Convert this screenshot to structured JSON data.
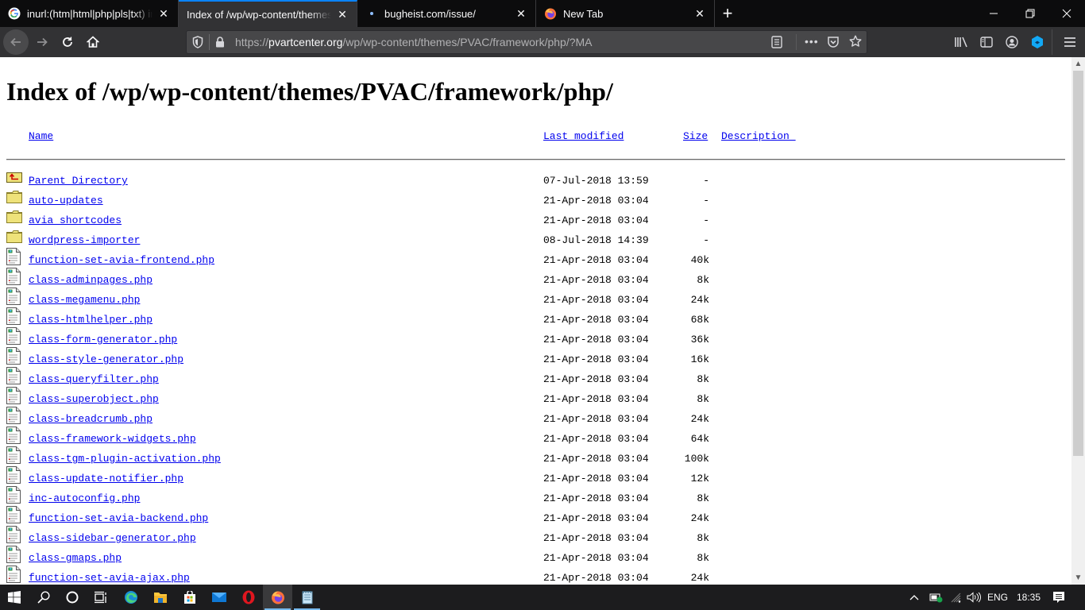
{
  "browser": {
    "tabs": [
      {
        "title": "inurl:(htm|html|php|pls|txt) intitle:index.of",
        "favicon": "google-g-icon",
        "active": false
      },
      {
        "title": "Index of /wp/wp-content/themes/PVAC/framework/php/",
        "favicon": "none",
        "active": true
      },
      {
        "title": "bugheist.com/issue/",
        "favicon": "loading-dot-icon",
        "active": false
      },
      {
        "title": "New Tab",
        "favicon": "firefox-icon",
        "active": false
      }
    ],
    "new_tab_label": "+",
    "url": {
      "scheme": "https://",
      "host": "pvartcenter.org",
      "path": "/wp/wp-content/themes/PVAC/framework/php/?MA"
    },
    "accent_color": "#0a84ff"
  },
  "page": {
    "title": "Index of /wp/wp-content/themes/PVAC/framework/php/",
    "columns": {
      "name": "Name",
      "last_modified": "Last modified",
      "size": "Size",
      "description": "Description "
    },
    "entries": [
      {
        "type": "parent",
        "name": "Parent Directory",
        "modified": "07-Jul-2018 13:59",
        "size": "-"
      },
      {
        "type": "folder",
        "name": "auto-updates",
        "modified": "21-Apr-2018 03:04",
        "size": "-"
      },
      {
        "type": "folder",
        "name": "avia_shortcodes",
        "modified": "21-Apr-2018 03:04",
        "size": "-"
      },
      {
        "type": "folder",
        "name": "wordpress-importer",
        "modified": "08-Jul-2018 14:39",
        "size": "-"
      },
      {
        "type": "file",
        "name": "function-set-avia-frontend.php",
        "modified": "21-Apr-2018 03:04",
        "size": "40k"
      },
      {
        "type": "file",
        "name": "class-adminpages.php",
        "modified": "21-Apr-2018 03:04",
        "size": "8k"
      },
      {
        "type": "file",
        "name": "class-megamenu.php",
        "modified": "21-Apr-2018 03:04",
        "size": "24k"
      },
      {
        "type": "file",
        "name": "class-htmlhelper.php",
        "modified": "21-Apr-2018 03:04",
        "size": "68k"
      },
      {
        "type": "file",
        "name": "class-form-generator.php",
        "modified": "21-Apr-2018 03:04",
        "size": "36k"
      },
      {
        "type": "file",
        "name": "class-style-generator.php",
        "modified": "21-Apr-2018 03:04",
        "size": "16k"
      },
      {
        "type": "file",
        "name": "class-queryfilter.php",
        "modified": "21-Apr-2018 03:04",
        "size": "8k"
      },
      {
        "type": "file",
        "name": "class-superobject.php",
        "modified": "21-Apr-2018 03:04",
        "size": "8k"
      },
      {
        "type": "file",
        "name": "class-breadcrumb.php",
        "modified": "21-Apr-2018 03:04",
        "size": "24k"
      },
      {
        "type": "file",
        "name": "class-framework-widgets.php",
        "modified": "21-Apr-2018 03:04",
        "size": "64k"
      },
      {
        "type": "file",
        "name": "class-tgm-plugin-activation.php",
        "modified": "21-Apr-2018 03:04",
        "size": "100k"
      },
      {
        "type": "file",
        "name": "class-update-notifier.php",
        "modified": "21-Apr-2018 03:04",
        "size": "12k"
      },
      {
        "type": "file",
        "name": "inc-autoconfig.php",
        "modified": "21-Apr-2018 03:04",
        "size": "8k"
      },
      {
        "type": "file",
        "name": "function-set-avia-backend.php",
        "modified": "21-Apr-2018 03:04",
        "size": "24k"
      },
      {
        "type": "file",
        "name": "class-sidebar-generator.php",
        "modified": "21-Apr-2018 03:04",
        "size": "8k"
      },
      {
        "type": "file",
        "name": "class-gmaps.php",
        "modified": "21-Apr-2018 03:04",
        "size": "8k"
      },
      {
        "type": "file",
        "name": "function-set-avia-ajax.php",
        "modified": "21-Apr-2018 03:04",
        "size": "24k"
      }
    ],
    "scroll_position": 0.0,
    "scroll_visible_fraction": 0.77
  },
  "taskbar": {
    "apps": [
      "start-icon",
      "search-icon",
      "cortana-icon",
      "task-view-icon",
      "edge-icon",
      "file-explorer-icon",
      "store-icon",
      "mail-icon",
      "opera-icon",
      "firefox-icon",
      "notepad-icon"
    ],
    "language": "ENG",
    "time": "18:35"
  }
}
